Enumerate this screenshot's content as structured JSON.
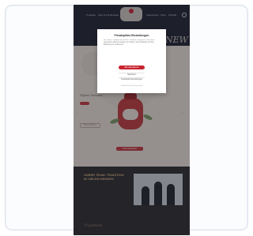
{
  "nav": {
    "items": [
      "Produkte",
      "Über Produkte",
      "Rezepte",
      "Verantwortung",
      "Shop",
      "Kontakt"
    ],
    "search_icon": "search-icon"
  },
  "hero": {
    "script_text": "NEW",
    "product_title": "Ripieni Sommer",
    "cta_primary": "Jetzt entdecken",
    "cta_secondary": "Mehr erfahren"
  },
  "team": {
    "title": "UNSER TEAM: TRADITION IN VIELEN HÄNDEN",
    "signature": "Tradition"
  },
  "cookie_modal": {
    "title": "Privatsphäre-Einstellungen",
    "body": "Wir nutzen Cookies auf unserer Website. Einige von ihnen sind essenziell, während andere uns helfen, diese Website und Ihre Erfahrung zu verbessern.",
    "accept_label": "Alle akzeptieren",
    "option_1": "Speichern",
    "option_2": "Individuelle Einstellungen",
    "links": "Cookie-Details | Datenschutz"
  },
  "colors": {
    "brand_red": "#c8252f",
    "header_dark": "#1e2230",
    "cream": "#ece4d9",
    "gold": "#d6b37a"
  }
}
